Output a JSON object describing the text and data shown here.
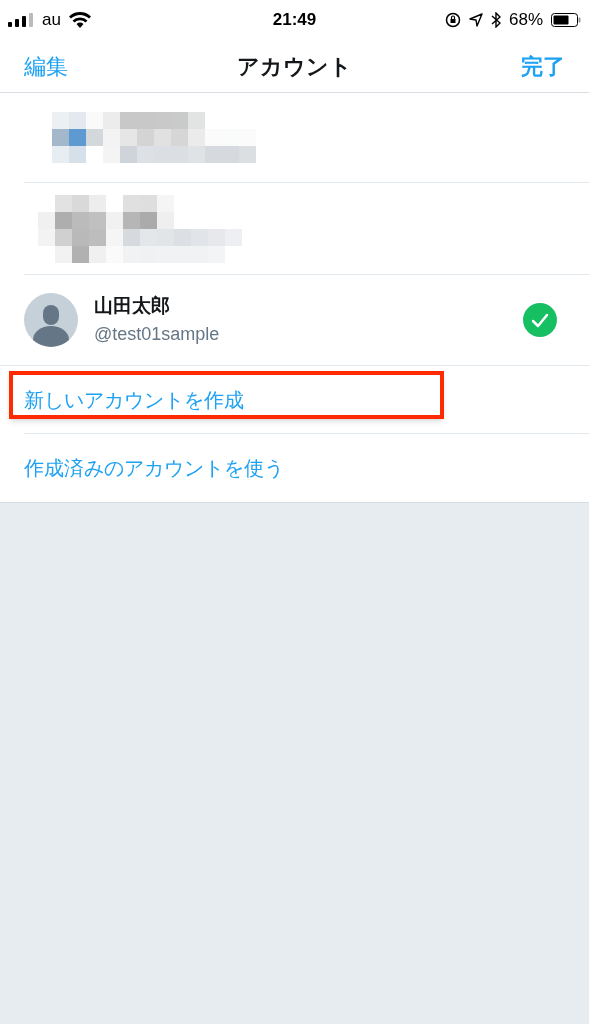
{
  "status_bar": {
    "carrier": "au",
    "time": "21:49",
    "battery": "68%"
  },
  "nav": {
    "left": "編集",
    "title": "アカウント",
    "right": "完了"
  },
  "accounts": [
    {
      "name": "山田太郎",
      "handle": "@test01sample",
      "selected": true
    }
  ],
  "actions": [
    {
      "label": "新しいアカウントを作成",
      "highlighted": true
    },
    {
      "label": "作成済みのアカウントを使う",
      "highlighted": false
    }
  ]
}
